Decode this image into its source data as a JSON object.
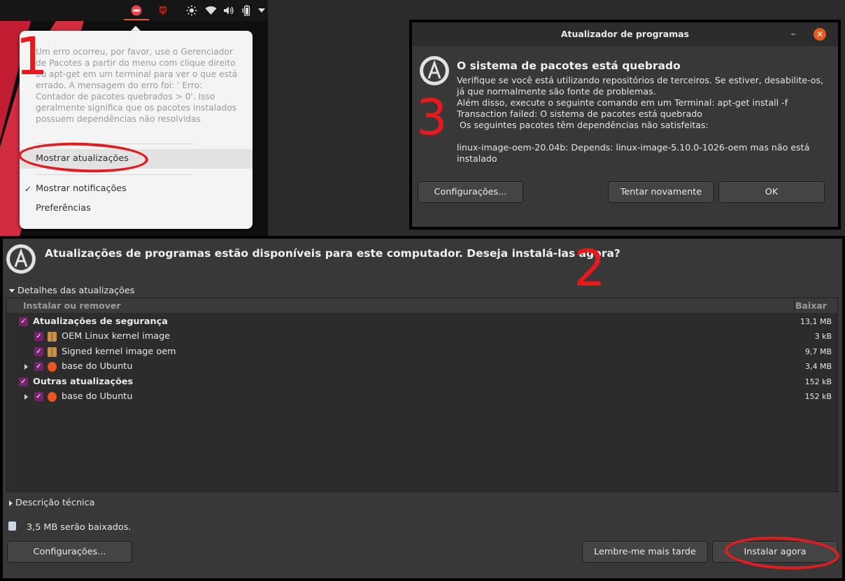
{
  "annotations": {
    "one": "1",
    "two": "2",
    "three": "3"
  },
  "panel1": {
    "error_text": "Um erro ocorreu, por favor, use o Gerenciador de Pacotes a partir do menu com clique direito ou apt-get em um terminal para ver o que está errado. A mensagem do erro foi: ' Erro: Contador de pacotes quebrados > 0'. Isso geralmente significa que os pacotes instalados possuem dependências não resolvidas",
    "menu_items": [
      {
        "label": "Mostrar atualizações",
        "checked": false,
        "highlighted": true
      },
      {
        "label": "Mostrar notificações",
        "checked": true,
        "highlighted": false
      },
      {
        "label": "Preferências",
        "checked": false,
        "highlighted": false
      }
    ],
    "check_mark": "✓",
    "tray_icons": [
      "update-error-icon",
      "mcafee-icon",
      "brightness-icon",
      "wifi-icon",
      "volume-icon",
      "battery-icon",
      "menu-arrow-icon"
    ]
  },
  "panel3": {
    "window_title": "Atualizador de programas",
    "minimize_glyph": "–",
    "close_glyph": "✕",
    "heading": "O sistema de pacotes está quebrado",
    "body": "Verifique se você está utilizando repositórios de terceiros. Se estiver, desabilite-os, já que normalmente são fonte de problemas.\nAlém disso, execute o seguinte comando em um Terminal: apt-get install -f\nTransaction failed: O sistema de pacotes está quebrado\n Os seguintes pacotes têm dependências não satisfeitas:\n\nlinux-image-oem-20.04b: Depends: linux-image-5.10.0-1026-oem mas não está instalado",
    "buttons": {
      "settings": "Configurações...",
      "retry": "Tentar novamente",
      "ok": "OK"
    }
  },
  "panel2": {
    "title": "Atualizações de programas estão disponíveis para este computador. Deseja instalá-las agora?",
    "details_label": "Detalhes das atualizações",
    "columns": {
      "name": "Instalar ou remover",
      "size": "Baixar"
    },
    "rows": [
      {
        "label": "Atualizações de segurança",
        "size": "13,1 MB",
        "bold": true,
        "level": 0,
        "icon": "",
        "expander": false
      },
      {
        "label": "OEM Linux kernel image",
        "size": "3 kB",
        "bold": false,
        "level": 1,
        "icon": "package-icon",
        "expander": false
      },
      {
        "label": "Signed kernel image oem",
        "size": "9,7 MB",
        "bold": false,
        "level": 1,
        "icon": "package-icon",
        "expander": false
      },
      {
        "label": "base do Ubuntu",
        "size": "3,4 MB",
        "bold": false,
        "level": 1,
        "icon": "ubuntu-icon",
        "expander": true
      },
      {
        "label": "Outras atualizações",
        "size": "152 kB",
        "bold": true,
        "level": 0,
        "icon": "",
        "expander": false
      },
      {
        "label": "base do Ubuntu",
        "size": "152 kB",
        "bold": false,
        "level": 1,
        "icon": "ubuntu-icon",
        "expander": true
      }
    ],
    "tech_desc_label": "Descrição técnica",
    "download_note": "3,5 MB serão baixados.",
    "buttons": {
      "settings": "Configurações...",
      "later": "Lembre-me mais tarde",
      "install": "Instalar agora"
    }
  }
}
